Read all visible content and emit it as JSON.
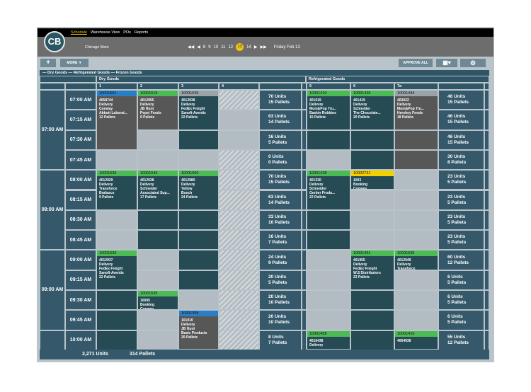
{
  "nav": {
    "items": [
      "Schedule",
      "Warehouse View",
      "POs",
      "Reports"
    ],
    "active": 0
  },
  "logo": "CB",
  "location": "Chicago Main",
  "date_nav": {
    "days": [
      "8",
      "9",
      "10",
      "11",
      "12",
      "13",
      "14"
    ],
    "selected": "13",
    "date_label": "Friday Feb 13",
    "first": "◀◀",
    "prev": "◀",
    "next": "▶",
    "last": "▶▶"
  },
  "toolbar": {
    "add": "+",
    "more": "MORE ▼",
    "approve_all": "APPROVE ALL",
    "view": "▦▾",
    "settings": "⚙"
  },
  "legend": "—  Dry Goods   —  Refrigerated Goods   —  Frozen Goods",
  "groups": {
    "dry": "Dry Goods",
    "refrigerated": "Refrigerated Goods"
  },
  "doors": [
    "1",
    "2",
    "3",
    "4",
    "5",
    "6",
    "7a"
  ],
  "hours": [
    "07:00 AM",
    "08:00 AM",
    "09:00 AM",
    ""
  ],
  "slots": [
    "07:00 AM",
    "07:15 AM",
    "07:30 AM",
    "07:45 AM",
    "08:00 AM",
    "08:15 AM",
    "08:30 AM",
    "08:45 AM",
    "09:00 AM",
    "09:15 AM",
    "09:30 AM",
    "09:45 AM",
    "10:00 AM"
  ],
  "cell_states": [
    [
      "gray",
      "gray",
      "dark",
      "hatch",
      "dark",
      "dark",
      "gray"
    ],
    [
      "gray",
      "gray",
      "dark",
      "light",
      "dark",
      "dark",
      "gray"
    ],
    [
      "gray",
      "light",
      "dark",
      "light",
      "dark",
      "dark",
      "gray"
    ],
    [
      "light",
      "light",
      "light",
      "hatch",
      "light",
      "dark",
      "gray"
    ],
    [
      "dark",
      "dark",
      "dark",
      "hatch",
      "dark",
      "dark",
      "light"
    ],
    [
      "dark",
      "dark",
      "dark",
      "hatch",
      "dark",
      "light",
      "light"
    ],
    [
      "light",
      "dark",
      "dark",
      "hatch",
      "dark",
      "light",
      "light"
    ],
    [
      "light",
      "dark",
      "dark",
      "hatch",
      "dark",
      "light",
      "light"
    ],
    [
      "dark",
      "light",
      "dark",
      "hatch",
      "light",
      "dark",
      "dark"
    ],
    [
      "dark",
      "light",
      "dark",
      "hatch",
      "light",
      "dark",
      "light"
    ],
    [
      "dark",
      "dark",
      "light",
      "hatch",
      "light",
      "dark",
      "light"
    ],
    [
      "dark",
      "light",
      "gray",
      "hatch",
      "light",
      "dark",
      "light"
    ],
    [
      "dark",
      "light",
      "gray",
      "hatch",
      "dark",
      "dark",
      "dark"
    ]
  ],
  "summary_dry": [
    [
      "70 Units",
      "15 Pallets"
    ],
    [
      "63 Units",
      "14 Pallets"
    ],
    [
      "16 Units",
      "5 Pallets"
    ],
    [
      "0 Units",
      "0 Pallets"
    ],
    [
      "70 Units",
      "15 Pallets"
    ],
    [
      "63 Units",
      "14 Pallets"
    ],
    [
      "33 Units",
      "10 Pallets"
    ],
    [
      "16 Units",
      "7 Pallets"
    ],
    [
      "24 Units",
      "9 Pallets"
    ],
    [
      "20 Units",
      "5 Pallets"
    ],
    [
      "20 Units",
      "10 Pallets"
    ],
    [
      "20 Units",
      "10 Pallets"
    ],
    [
      "8 Units",
      "7 Pallets"
    ]
  ],
  "summary_refrigerated": [
    [
      "46 Units",
      "15 Pallets"
    ],
    [
      "46 Units",
      "15 Pallets"
    ],
    [
      "46 Units",
      "15 Pallets"
    ],
    [
      "30 Units",
      "8 Pallets"
    ],
    [
      "23 Units",
      "5 Pallets"
    ],
    [
      "23 Units",
      "5 Pallets"
    ],
    [
      "23 Units",
      "5 Pallets"
    ],
    [
      "23 Units",
      "5 Pallets"
    ],
    [
      "60 Units",
      "12 Pallets"
    ],
    [
      "6 Units",
      "5 Pallets"
    ],
    [
      "6 Units",
      "5 Pallets"
    ],
    [
      "6 Units",
      "5 Pallets"
    ],
    [
      "55 Units",
      "12 Pallets"
    ]
  ],
  "colors": {
    "blue": "#2a7fc4",
    "green": "#4cbb55",
    "gray": "#9aa3a8",
    "yellow": "#f5d000",
    "dark": "#264b55",
    "graybody": "#575757"
  },
  "appointments": [
    {
      "door": 0,
      "row": 0,
      "span": 3,
      "head": "blue",
      "body": "graybody",
      "id": "10001551",
      "lines": [
        "4058744",
        "Delivery",
        "Conway",
        "Abbott Laborat...",
        "12 Pallets"
      ]
    },
    {
      "door": 1,
      "row": 0,
      "span": 2,
      "head": "green",
      "body": "graybody",
      "id": "10001519",
      "lines": [
        "4012955",
        "Delivery",
        "JB Hunt",
        "Pepsi Foods",
        "9 Pallets"
      ]
    },
    {
      "door": 2,
      "row": 0,
      "span": 2,
      "head": "gray",
      "body": "dark",
      "id": "10001535",
      "lines": [
        "4012938",
        "Delivery",
        "FedEx Freight",
        "Sanofi-Aventis",
        "22 Pallets"
      ]
    },
    {
      "door": 4,
      "row": 0,
      "span": 2,
      "head": "green",
      "body": "dark",
      "id": "10001410",
      "lines": [
        "401019",
        "Delivery",
        "Mom&Pop Tru...",
        "Baskin Robbins",
        "15 Pallets"
      ]
    },
    {
      "door": 5,
      "row": 0,
      "span": 2,
      "head": "green",
      "body": "dark",
      "id": "10001436",
      "lines": [
        "401419",
        "Delivery",
        "Schneider",
        "The Chocolate...",
        "20 Pallets"
      ]
    },
    {
      "door": 6,
      "row": 0,
      "span": 2,
      "head": "gray",
      "body": "graybody",
      "id": "10001444",
      "lines": [
        "403022",
        "Delivery",
        "Mom&Pop Tru...",
        "Hershey Foods",
        "18 Pallets"
      ]
    },
    {
      "door": 0,
      "row": 4,
      "span": 2,
      "head": "green",
      "body": "dark",
      "id": "10001535",
      "lines": [
        "4012929",
        "Delivery",
        "Transforce",
        "Brafasco",
        "9 Pallets"
      ]
    },
    {
      "door": 1,
      "row": 4,
      "span": 2,
      "head": "green",
      "body": "dark",
      "id": "10001543",
      "lines": [
        "4012938",
        "Delivery",
        "Schneider",
        "Associated Sup...",
        "17 Pallets"
      ]
    },
    {
      "door": 2,
      "row": 4,
      "span": 2,
      "head": "green",
      "body": "dark",
      "id": "10001550",
      "lines": [
        "4012980",
        "Delivery",
        "Yellow",
        "Bosch",
        "24 Pallets"
      ]
    },
    {
      "door": 4,
      "row": 4,
      "span": 2,
      "head": "green",
      "body": "dark",
      "id": "10001428",
      "lines": [
        "401330",
        "Delivery",
        "Schneider",
        "Gerber Produ...",
        "22 Pallets"
      ]
    },
    {
      "door": 5,
      "row": 4,
      "span": 1,
      "head": "yellow",
      "body": "dark",
      "id": "10002731",
      "lines": [
        "1003",
        "Booking",
        "Conway"
      ]
    },
    {
      "door": 0,
      "row": 8,
      "span": 2,
      "head": "green",
      "body": "dark",
      "id": "10001593",
      "lines": [
        "4012937",
        "Delivery",
        "FedEx Freight",
        "Sanofi-Aventis",
        "22 Pallets"
      ]
    },
    {
      "door": 5,
      "row": 8,
      "span": 2,
      "head": "green",
      "body": "dark",
      "id": "10001451",
      "lines": [
        "401955",
        "Delivery",
        "FedEx Freight",
        "W.S Distributors",
        "22 Pallets"
      ]
    },
    {
      "door": 6,
      "row": 8,
      "span": 1,
      "head": "green",
      "body": "dark",
      "id": "10001535",
      "lines": [
        "4012949",
        "Delivery",
        "Transforce"
      ]
    },
    {
      "door": 1,
      "row": 10,
      "span": 1,
      "head": "green",
      "body": "dark",
      "id": "10001535",
      "lines": [
        "10005",
        "Booking",
        "Conway"
      ]
    },
    {
      "door": 2,
      "row": 11,
      "span": 2,
      "head": "blue",
      "body": "graybody",
      "id": "10001399",
      "lines": [
        "101010",
        "Delivery",
        "JB Hunt",
        "Basic Products",
        "20 Pallets"
      ]
    },
    {
      "door": 4,
      "row": 12,
      "span": 1,
      "head": "green",
      "body": "dark",
      "id": "10001458",
      "lines": [
        "4016438",
        "Delivery"
      ]
    },
    {
      "door": 6,
      "row": 12,
      "span": 1,
      "head": "green",
      "body": "dark",
      "id": "10001410",
      "lines": [
        "4064938"
      ]
    }
  ],
  "footer": {
    "units": "2,271 Units",
    "pallets": "314 Pallets"
  }
}
